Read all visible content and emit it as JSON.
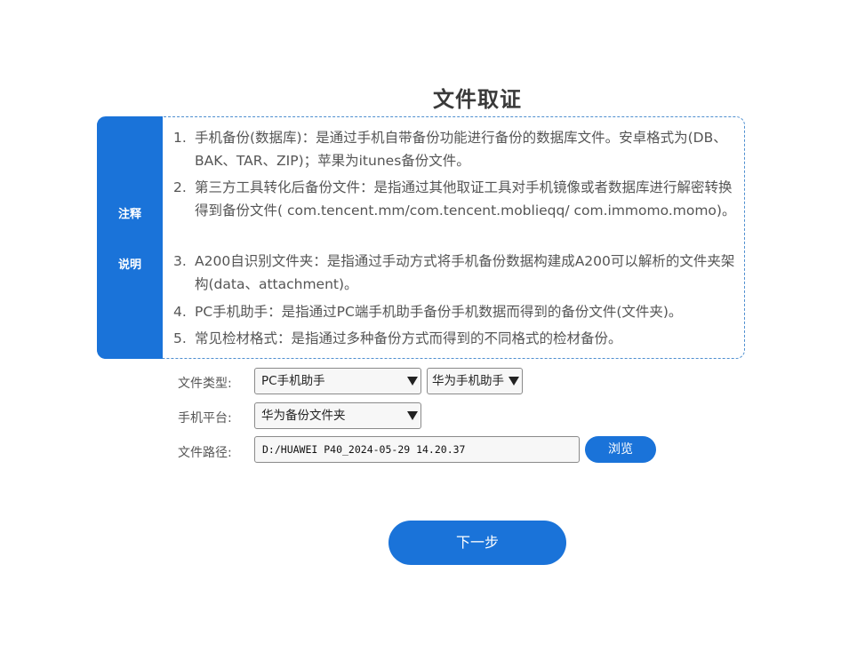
{
  "page_title": "文件取证",
  "notes": {
    "side_label_1": "注释",
    "side_label_2": "说明",
    "items": [
      {
        "num": "1.",
        "text": "手机备份(数据库)：是通过手机自带备份功能进行备份的数据库文件。安卓格式为(DB、BAK、TAR、ZIP)；苹果为itunes备份文件。"
      },
      {
        "num": "2.",
        "text": "第三方工具转化后备份文件：是指通过其他取证工具对手机镜像或者数据库进行解密转换得到备份文件( com.tencent.mm/com.tencent.moblieqq/ com.immomo.momo)。"
      },
      {
        "num": "3.",
        "text": "A200自识别文件夹：是指通过手动方式将手机备份数据构建成A200可以解析的文件夹架构(data、attachment)。"
      },
      {
        "num": "4.",
        "text": "PC手机助手：是指通过PC端手机助手备份手机数据而得到的备份文件(文件夹)。"
      },
      {
        "num": "5.",
        "text": "常见检材格式：是指通过多种备份方式而得到的不同格式的检材备份。"
      }
    ]
  },
  "form": {
    "file_type_label": "文件类型:",
    "file_type_value": "PC手机助手",
    "assistant_value": "华为手机助手",
    "platform_label": "手机平台:",
    "platform_value": "华为备份文件夹",
    "path_label": "文件路径:",
    "path_value": "D:/HUAWEI P40_2024-05-29 14.20.37",
    "browse_label": "浏览"
  },
  "next_label": "下一步",
  "colors": {
    "accent": "#1a73d9",
    "panel_border": "#4f8fd0"
  }
}
